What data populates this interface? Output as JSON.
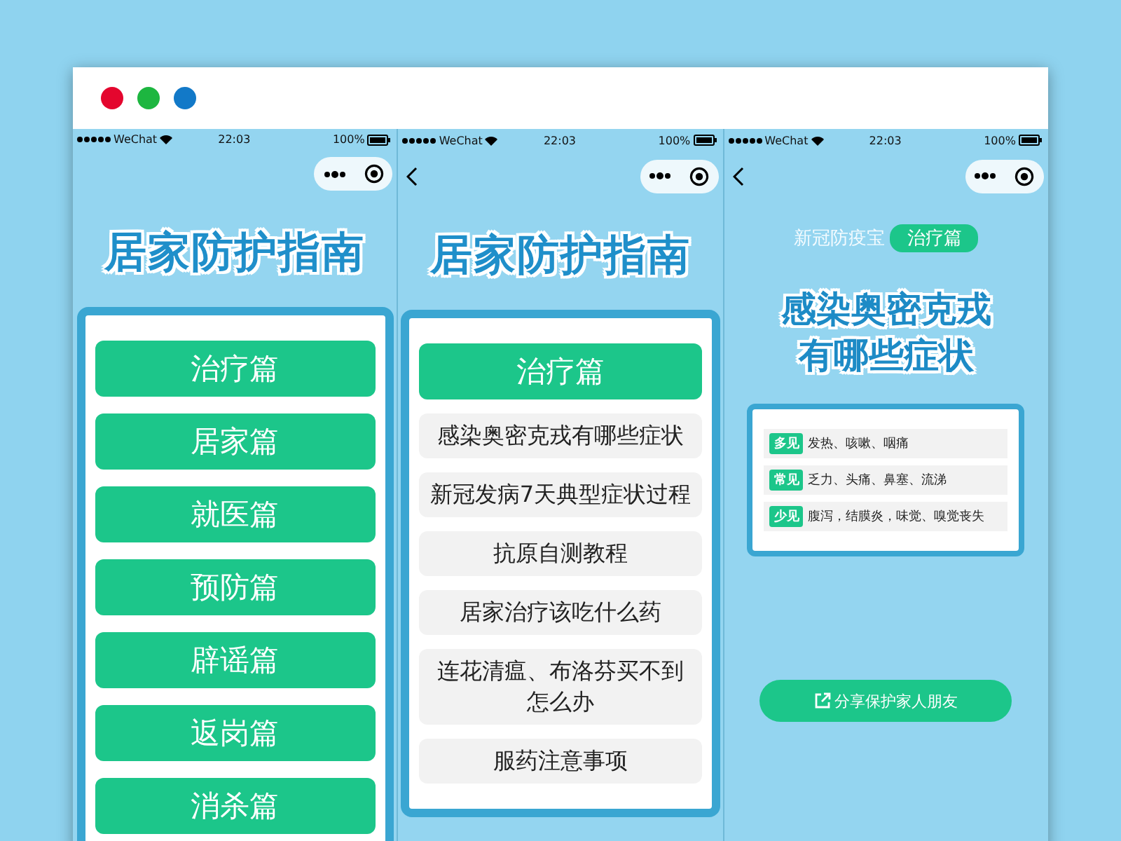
{
  "window": {
    "controls": [
      {
        "color": "#e4062e"
      },
      {
        "color": "#1db640"
      },
      {
        "color": "#1279c8"
      }
    ]
  },
  "screens": [
    {
      "status_bar": {
        "carrier": "WeChat",
        "time": "22:03",
        "battery": "100%"
      },
      "back": false,
      "kind": "menu",
      "title": "居家防护指南",
      "items": [
        {
          "label": "治疗篇"
        },
        {
          "label": "居家篇"
        },
        {
          "label": "就医篇"
        },
        {
          "label": "预防篇"
        },
        {
          "label": "辟谣篇"
        },
        {
          "label": "返岗篇"
        },
        {
          "label": "消杀篇"
        }
      ]
    },
    {
      "status_bar": {
        "carrier": "WeChat",
        "time": "22:03",
        "battery": "100%"
      },
      "back": true,
      "kind": "list",
      "title": "居家防护指南",
      "items": [
        {
          "kind": "header",
          "label": "治疗篇"
        },
        {
          "kind": "item",
          "label": "感染奥密克戎有哪些症状"
        },
        {
          "kind": "item",
          "label": "新冠发病7天典型症状过程"
        },
        {
          "kind": "item",
          "label": "抗原自测教程"
        },
        {
          "kind": "item",
          "label": "居家治疗该吃什么药"
        },
        {
          "kind": "item",
          "label": "连花清瘟、布洛芬买不到怎么办"
        },
        {
          "kind": "item",
          "label": "服药注意事项"
        }
      ]
    },
    {
      "status_bar": {
        "carrier": "WeChat",
        "time": "22:03",
        "battery": "100%"
      },
      "back": true,
      "kind": "article",
      "subtitle": "新冠防疫宝",
      "tag": "治疗篇",
      "heading_lines": [
        "感染奥密克戎",
        "有哪些症状"
      ],
      "symptoms": [
        {
          "label": "多见",
          "text": "发热、咳嗽、咽痛"
        },
        {
          "label": "常见",
          "text": "乏力、头痛、鼻塞、流涕"
        },
        {
          "label": "少见",
          "text": "腹泻，结膜炎，味觉、嗅觉丧失"
        }
      ],
      "share_button": "分享保护家人朋友"
    }
  ]
}
